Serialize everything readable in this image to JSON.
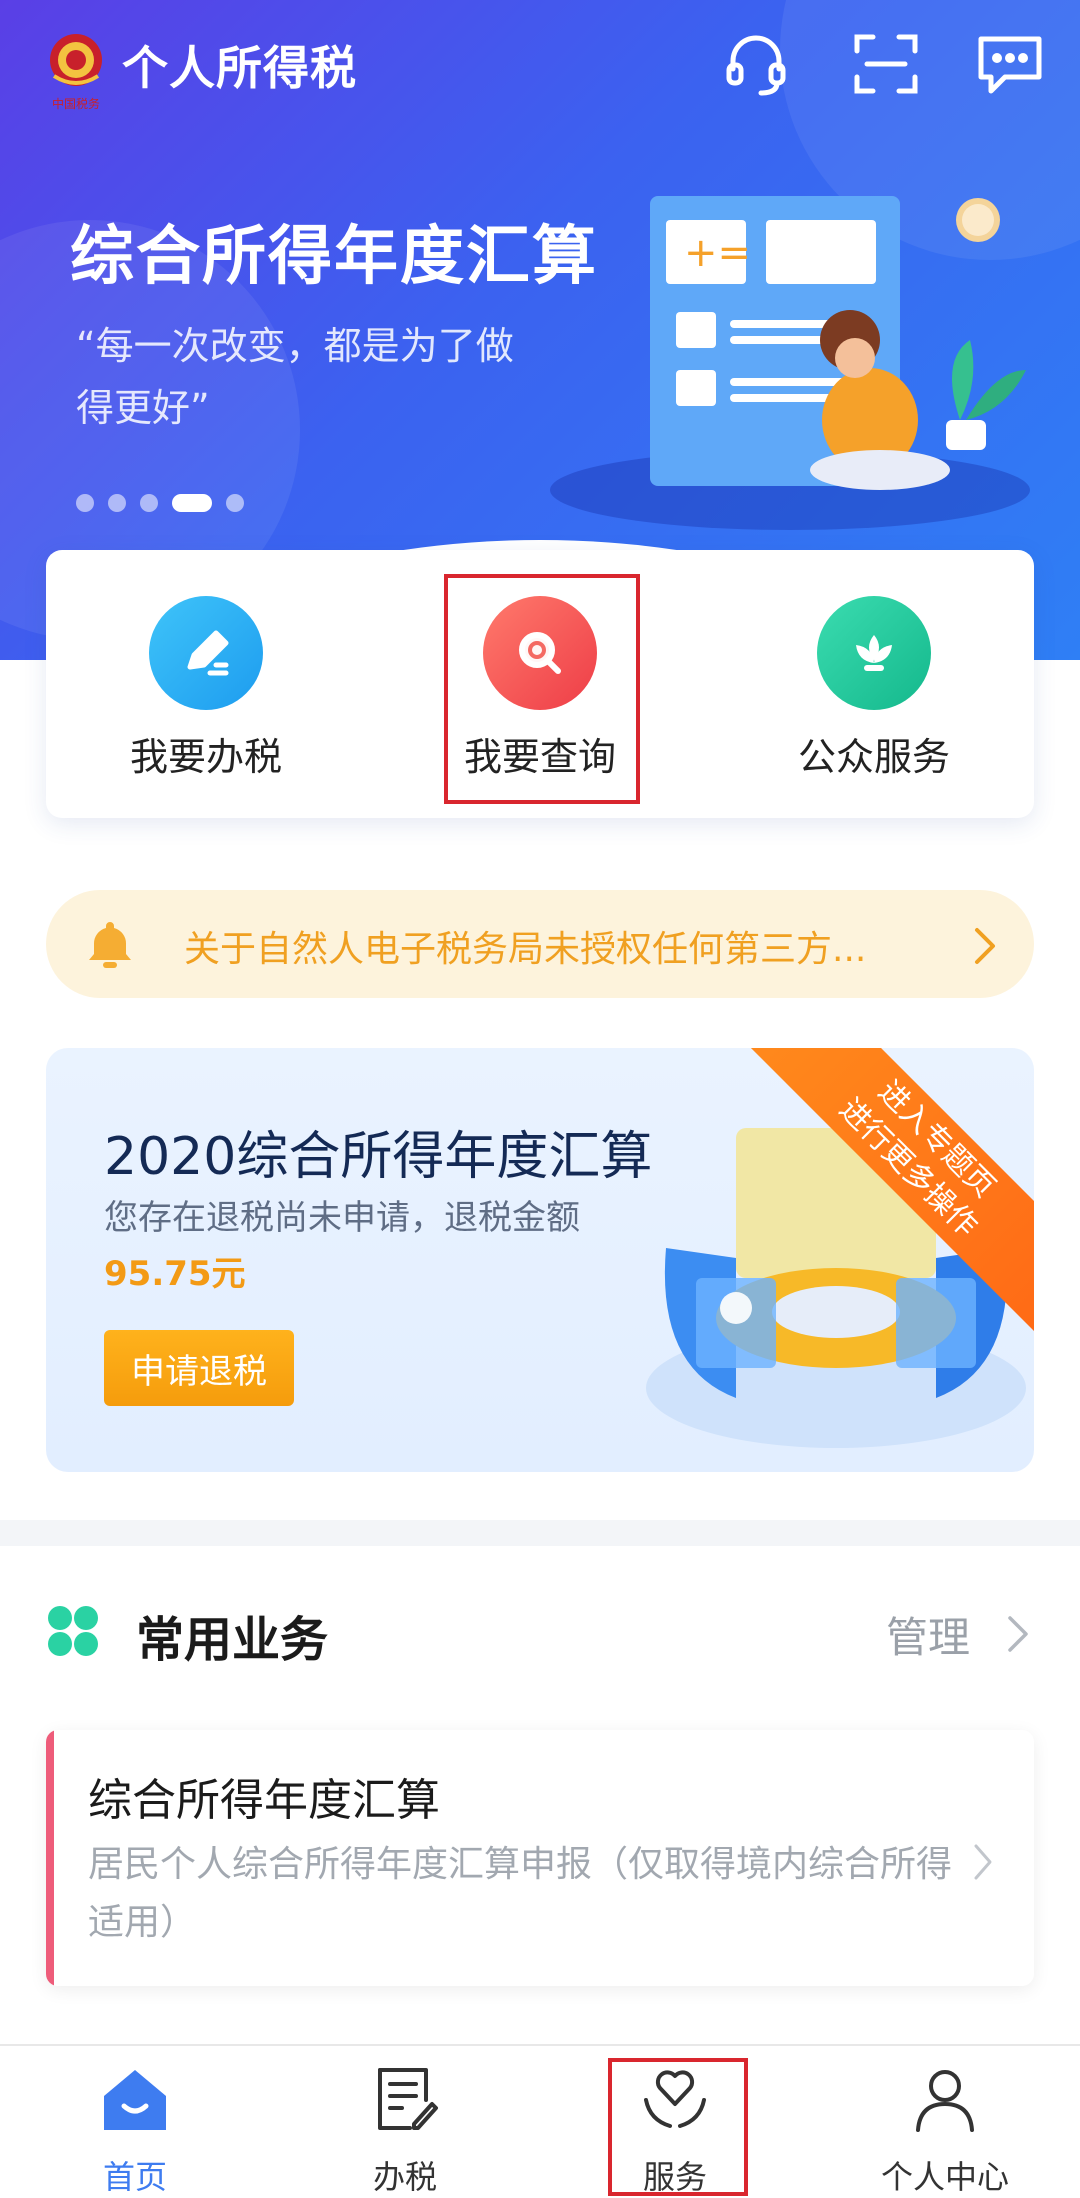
{
  "app": {
    "title": "个人所得税",
    "logo_text": "中国税务"
  },
  "header_icons": [
    "headset-icon",
    "scan-icon",
    "message-icon"
  ],
  "banner": {
    "title": "综合所得年度汇算",
    "subtitle": "“每一次改变，都是为了做得更好”",
    "slide_count": 5,
    "active_slide": 4
  },
  "quick_actions": [
    {
      "label": "我要办税",
      "icon": "edit-icon",
      "color": "#27aef3"
    },
    {
      "label": "我要查询",
      "icon": "search-icon",
      "color": "#f2554f"
    },
    {
      "label": "公众服务",
      "icon": "lotus-icon",
      "color": "#22c29b"
    }
  ],
  "notice": {
    "text": "关于自然人电子税务局未授权任何第三方..."
  },
  "promo": {
    "title": "2020综合所得年度汇算",
    "subtitle": "您存在退税尚未申请，退税金额",
    "amount": "95.75元",
    "button": "申请退税",
    "ribbon_line1": "进入专题页",
    "ribbon_line2": "进行更多操作"
  },
  "common_services": {
    "title": "常用业务",
    "manage": "管理",
    "items": [
      {
        "title": "综合所得年度汇算",
        "description": "居民个人综合所得年度汇算申报（仅取得境内综合所得适用）"
      }
    ]
  },
  "bottom_nav": [
    {
      "label": "首页",
      "icon": "home-icon",
      "active": true
    },
    {
      "label": "办税",
      "icon": "tax-form-icon",
      "active": false
    },
    {
      "label": "服务",
      "icon": "heart-hand-icon",
      "active": false
    },
    {
      "label": "个人中心",
      "icon": "user-icon",
      "active": false
    }
  ],
  "colors": {
    "accent": "#3e7cf0",
    "warning": "#f0a021",
    "highlight": "#d9262e"
  }
}
